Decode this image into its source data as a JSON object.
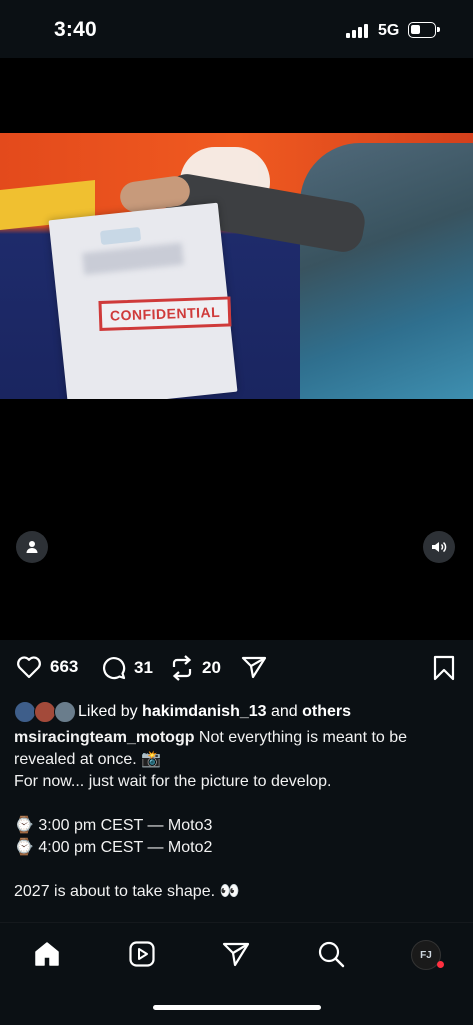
{
  "status_bar": {
    "time": "3:40",
    "network": "5G"
  },
  "video": {
    "sticker_text": "CONFIDENTIAL",
    "icons": [
      "person-icon",
      "speaker-icon"
    ]
  },
  "actions": {
    "likes": "663",
    "comments": "31",
    "reposts": "20"
  },
  "liked_by": {
    "prefix": "Liked by ",
    "user": "hakimdanish_13",
    "middle": " and ",
    "suffix": "others"
  },
  "caption": {
    "username": "msiracingteam_motogp",
    "line1": " Not everything is meant to be revealed at once. 📸",
    "line2": "For now... just wait for the picture to develop.",
    "schedule1": "⌚ 3:00 pm CEST — Moto3",
    "schedule2": "⌚ 4:00 pm CEST — Moto2",
    "line3": "2027 is about to take shape. 👀"
  },
  "tabbar": {
    "items": [
      "home-icon",
      "reels-icon",
      "send-icon",
      "search-icon",
      "profile-avatar"
    ],
    "avatar_text": "FJ"
  },
  "colors": {
    "background": "#0b1014",
    "accent_red": "#ff3040",
    "confidential_red": "#cf3a3a"
  }
}
